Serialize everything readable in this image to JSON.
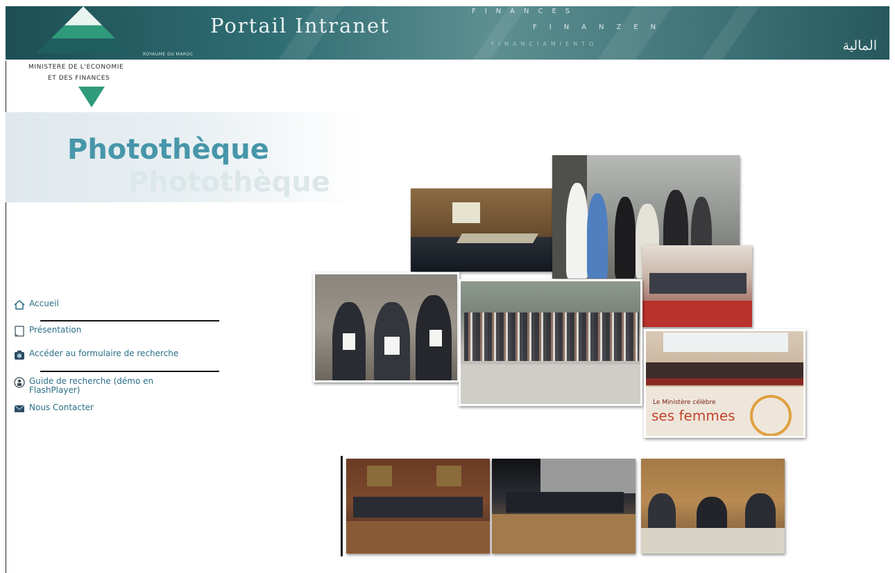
{
  "header": {
    "title": "Portail Intranet",
    "royaume": "ROYAUME DU MAROC",
    "finances_words": [
      "FINANCES",
      "FINANZEN",
      "FINANCIAMIENTO"
    ],
    "arabic": "المالية"
  },
  "ministry": {
    "line1": "MINISTERE DE L'ECONOMIE",
    "line2": "ET DES FINANCES"
  },
  "page": {
    "title": "Photothèque",
    "title_reflection": "Photothèque"
  },
  "menu": {
    "items": [
      {
        "label": "Accueil",
        "icon": "home-icon"
      },
      {
        "label": "Présentation",
        "icon": "document-icon"
      },
      {
        "label": "Accéder au formulaire de recherche",
        "icon": "camera-icon"
      },
      {
        "label": "Guide de recherche (démo en FlashPlayer)",
        "icon": "help-icon"
      },
      {
        "label": "Nous Contacter",
        "icon": "mail-icon"
      }
    ]
  },
  "photo_banner": {
    "text_line1": "Le Ministère célèbre",
    "text_line2": "ses femmes"
  },
  "colors": {
    "banner": "#2f6d73",
    "title": "#4796aa",
    "menu_link": "#2a6f86",
    "logo_green": "#2f9b7a"
  }
}
